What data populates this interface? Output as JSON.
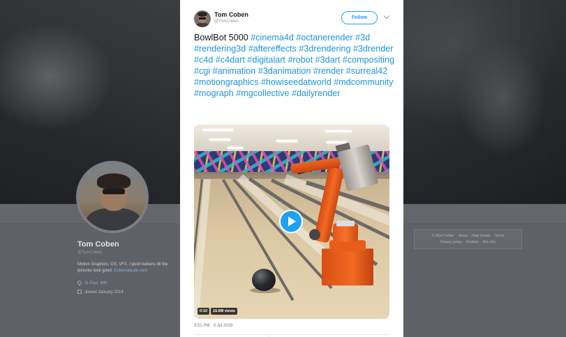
{
  "profile": {
    "name": "Tom Coben",
    "handle": "@TomCoben",
    "bio_text": "Motion Graphics, CG, VFX. I push buttons till the pictures look good. ",
    "bio_link": "Cobenstitude.com",
    "location": "St Paul, MN",
    "joined": "Joined January 2014"
  },
  "footer": {
    "row1": [
      "© 2019 Twitter",
      "About",
      "Help Center",
      "Terms"
    ],
    "row2": [
      "Privacy policy",
      "Cookies",
      "Ads info"
    ]
  },
  "tweet": {
    "author_name": "Tom Coben",
    "author_handle": "@TomCoben",
    "follow_label": "Follow",
    "text_lead": "BowlBot 5000 ",
    "hashtags": [
      "#cinema4d",
      "#octanerender",
      "#3d",
      "#rendering3d",
      "#aftereffects",
      "#3drendering",
      "#3drender",
      "#c4d",
      "#c4dart",
      "#digitalart",
      "#robot",
      "#3dart",
      "#compositing",
      "#cgi",
      "#animation",
      "#3danimation",
      "#render",
      "#surreal42",
      "#motiongraphics",
      "#howiseedatworld",
      "#mdcommunity",
      "#mograph",
      "#mgcollective",
      "#dailyrender"
    ],
    "video_duration": "0:10",
    "video_views": "16.6M views",
    "timestamp": "9:51 PM · 3 Jul 2019"
  },
  "colors": {
    "accent": "#1da1f2",
    "hashtag": "#1b95e0",
    "text": "#14171a",
    "muted": "#8899a6"
  },
  "icons": [
    "caret-down-icon",
    "play-icon",
    "location-pin-icon",
    "calendar-icon"
  ]
}
